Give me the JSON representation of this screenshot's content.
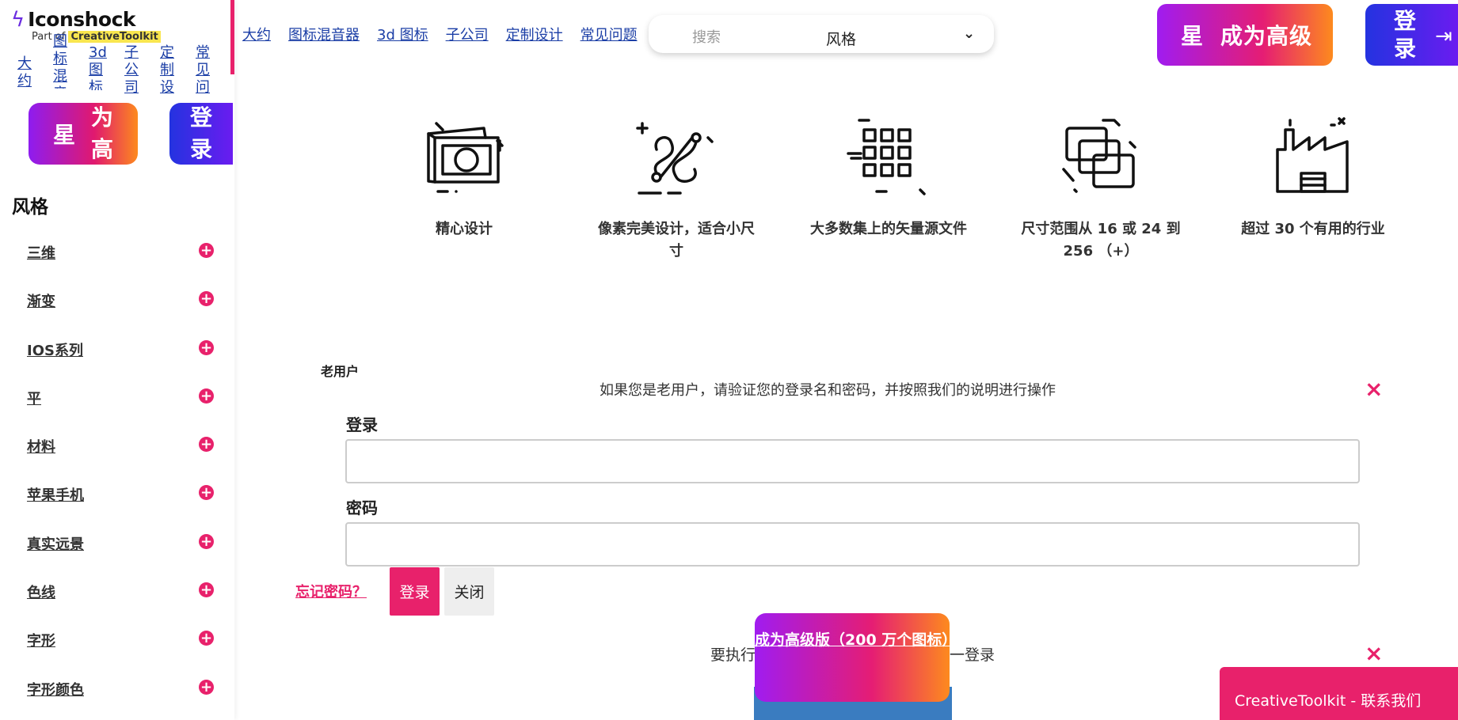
{
  "brand": {
    "name": "Iconshock",
    "sub_prefix": "Part of",
    "sub_toolkit": "CreativeToolkit"
  },
  "nav": [
    "大约",
    "图标混音器",
    "3d 图标",
    "子公司",
    "定制设计",
    "常见问题"
  ],
  "sidebar": {
    "mini_nav": [
      {
        "label": "大\n约"
      },
      {
        "label": "图\n标\n混\n音"
      },
      {
        "label": "3d\n图\n标"
      },
      {
        "label": "子\n公\n司"
      },
      {
        "label": "定\n制\n设"
      },
      {
        "label": "常\n见\n问"
      }
    ],
    "pro_star": "星",
    "pro_label_1": "为",
    "pro_label_2": "高",
    "login_1": "登",
    "login_2": "录",
    "style_heading": "风格",
    "styles": [
      "三维",
      "渐变",
      "IOS系列",
      "平",
      "材料",
      "苹果手机",
      "真实远景",
      "色线",
      "字形",
      "字形颜色"
    ],
    "plus_icon": "+"
  },
  "search": {
    "placeholder": "搜索",
    "select_value": "风格",
    "chevron": "⌄"
  },
  "header": {
    "pro_star": "星",
    "pro_label": "成为高级",
    "login_1": "登",
    "login_2": "录",
    "login_arrow": "⇥"
  },
  "features": [
    {
      "icon": "photo-frame-icon",
      "text": "精心设计"
    },
    {
      "icon": "vector-path-icon",
      "text": "像素完美设计，适合小尺寸"
    },
    {
      "icon": "grid-icon",
      "text": "大多数集上的矢量源文件"
    },
    {
      "icon": "resize-layers-icon",
      "text": "尺寸范围从 16 或 24 到 256 （+）"
    },
    {
      "icon": "factory-icon",
      "text": "超过 30 个有用的行业"
    }
  ],
  "old_user": {
    "title": "老用户",
    "description": "如果您是老用户，请验证您的登录名和密码，并按照我们的说明进行操作",
    "login_label": "登录",
    "password_label": "密码",
    "forgot": "忘记密码？",
    "login_button": "登录",
    "close_button": "关闭",
    "close_x": "×"
  },
  "bottom": {
    "text_left": "要执行",
    "text_right": "一登录",
    "pro_float": "成为高级版（200 万个图标）",
    "contact": "CreativeToolkit - 联系我们",
    "close_x": "×"
  },
  "colors": {
    "accent": "#e8216b",
    "link": "#1b3ea6",
    "login_gradient_start": "#2433e0"
  }
}
